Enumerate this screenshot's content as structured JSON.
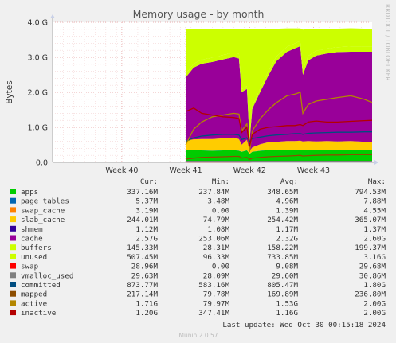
{
  "chart_data": {
    "type": "area",
    "title": "Memory usage - by month",
    "ylabel": "Bytes",
    "ylim": [
      0,
      4.0
    ],
    "y_unit": "G",
    "y_ticks": [
      "0.0",
      "1.0 G",
      "2.0 G",
      "3.0 G",
      "4.0 G"
    ],
    "x_ticks": [
      "Week 40",
      "Week 41",
      "Week 42",
      "Week 43"
    ],
    "x_tick_positions": [
      2.6,
      5.0,
      7.4,
      9.8
    ],
    "xlim": [
      0,
      12
    ],
    "grid": true,
    "side_label": "RRDTOOL / TOBI OETIKER",
    "legend_headers": [
      "Cur:",
      "Min:",
      "Avg:",
      "Max:"
    ],
    "stack_order": [
      "apps",
      "page_tables",
      "swap_cache",
      "slab_cache",
      "shmem",
      "cache",
      "buffers",
      "unused"
    ],
    "line_order": [
      "swap",
      "vmalloc_used",
      "committed",
      "mapped",
      "active",
      "inactive"
    ],
    "x": [
      5.0,
      5.3,
      5.6,
      6.0,
      6.4,
      6.8,
      7.0,
      7.1,
      7.3,
      7.4,
      7.5,
      7.8,
      8.1,
      8.4,
      8.8,
      9.1,
      9.3,
      9.4,
      9.6,
      9.9,
      10.3,
      10.7,
      11.2,
      11.7,
      12.0
    ],
    "series": [
      {
        "name": "apps",
        "color": "#00cc00",
        "cur": "337.16M",
        "min": "237.84M",
        "avg": "348.65M",
        "max": "794.53M",
        "values": [
          0.34,
          0.35,
          0.34,
          0.33,
          0.34,
          0.35,
          0.33,
          0.3,
          0.34,
          0.24,
          0.3,
          0.33,
          0.35,
          0.34,
          0.35,
          0.34,
          0.35,
          0.34,
          0.35,
          0.34,
          0.35,
          0.34,
          0.35,
          0.34,
          0.34
        ]
      },
      {
        "name": "page_tables",
        "color": "#0066b3",
        "cur": "5.37M",
        "min": "3.48M",
        "avg": "4.96M",
        "max": "7.88M",
        "values": [
          0.005,
          0.005,
          0.005,
          0.005,
          0.005,
          0.005,
          0.005,
          0.005,
          0.005,
          0.004,
          0.005,
          0.005,
          0.005,
          0.005,
          0.005,
          0.005,
          0.005,
          0.005,
          0.005,
          0.005,
          0.005,
          0.005,
          0.005,
          0.005,
          0.005
        ]
      },
      {
        "name": "swap_cache",
        "color": "#ff8000",
        "cur": "3.19M",
        "min": "0.00",
        "avg": "1.39M",
        "max": "4.55M",
        "values": [
          0.0,
          0.001,
          0.001,
          0.001,
          0.001,
          0.001,
          0.001,
          0.001,
          0.001,
          0.0,
          0.001,
          0.001,
          0.001,
          0.001,
          0.001,
          0.001,
          0.002,
          0.002,
          0.002,
          0.002,
          0.003,
          0.003,
          0.003,
          0.003,
          0.003
        ]
      },
      {
        "name": "slab_cache",
        "color": "#ffcc00",
        "cur": "244.01M",
        "min": "74.79M",
        "avg": "254.42M",
        "max": "365.07M",
        "values": [
          0.28,
          0.3,
          0.32,
          0.33,
          0.34,
          0.35,
          0.33,
          0.2,
          0.3,
          0.08,
          0.12,
          0.18,
          0.22,
          0.24,
          0.25,
          0.26,
          0.26,
          0.25,
          0.25,
          0.25,
          0.25,
          0.25,
          0.25,
          0.24,
          0.24
        ]
      },
      {
        "name": "shmem",
        "color": "#330099",
        "cur": "1.12M",
        "min": "1.08M",
        "avg": "1.17M",
        "max": "1.37M",
        "values": [
          0.001,
          0.001,
          0.001,
          0.001,
          0.001,
          0.001,
          0.001,
          0.001,
          0.001,
          0.001,
          0.001,
          0.001,
          0.001,
          0.001,
          0.001,
          0.001,
          0.001,
          0.001,
          0.001,
          0.001,
          0.001,
          0.001,
          0.001,
          0.001,
          0.001
        ]
      },
      {
        "name": "cache",
        "color": "#990099",
        "cur": "2.57G",
        "min": "253.06M",
        "avg": "2.32G",
        "max": "2.60G",
        "values": [
          1.8,
          2.05,
          2.15,
          2.2,
          2.25,
          2.3,
          2.3,
          1.5,
          1.45,
          0.3,
          1.1,
          1.5,
          1.9,
          2.3,
          2.55,
          2.65,
          2.7,
          1.9,
          2.3,
          2.45,
          2.5,
          2.55,
          2.55,
          2.57,
          2.57
        ]
      },
      {
        "name": "buffers",
        "color": "#ccff00",
        "cur": "145.33M",
        "min": "28.31M",
        "avg": "158.22M",
        "max": "199.37M",
        "values": [
          0.1,
          0.11,
          0.12,
          0.12,
          0.13,
          0.13,
          0.13,
          0.08,
          0.08,
          0.03,
          0.08,
          0.1,
          0.12,
          0.13,
          0.14,
          0.14,
          0.15,
          0.12,
          0.13,
          0.14,
          0.14,
          0.14,
          0.15,
          0.15,
          0.15
        ]
      },
      {
        "name": "unused",
        "color": "#ccff00",
        "cur": "507.45M",
        "min": "96.33M",
        "avg": "733.85M",
        "max": "3.16G",
        "values": [
          1.27,
          0.98,
          0.86,
          0.81,
          0.75,
          0.68,
          0.72,
          1.72,
          1.63,
          3.15,
          2.2,
          1.69,
          1.22,
          0.8,
          0.53,
          0.43,
          0.36,
          1.17,
          0.78,
          0.63,
          0.57,
          0.53,
          0.52,
          0.51,
          0.51
        ]
      },
      {
        "name": "swap",
        "color": "#ff0000",
        "cur": "28.96M",
        "min": "0.00",
        "avg": "9.08M",
        "max": "29.68M",
        "values": [
          0.0,
          0.0,
          0.0,
          0.0,
          0.0,
          0.0,
          0.0,
          0.0,
          0.0,
          0.0,
          0.005,
          0.005,
          0.006,
          0.007,
          0.008,
          0.009,
          0.01,
          0.01,
          0.012,
          0.015,
          0.02,
          0.025,
          0.028,
          0.029,
          0.029
        ]
      },
      {
        "name": "vmalloc_used",
        "color": "#808080",
        "cur": "29.63M",
        "min": "28.09M",
        "avg": "29.60M",
        "max": "30.86M",
        "values": [
          0.029,
          0.029,
          0.029,
          0.029,
          0.029,
          0.029,
          0.029,
          0.029,
          0.029,
          0.028,
          0.029,
          0.029,
          0.029,
          0.029,
          0.029,
          0.029,
          0.03,
          0.03,
          0.03,
          0.03,
          0.03,
          0.03,
          0.03,
          0.03,
          0.03
        ]
      },
      {
        "name": "committed",
        "color": "#004d80",
        "cur": "873.77M",
        "min": "583.16M",
        "avg": "805.47M",
        "max": "1.80G",
        "values": [
          0.6,
          0.7,
          0.75,
          0.78,
          0.8,
          0.8,
          0.78,
          0.65,
          0.7,
          0.6,
          0.68,
          0.72,
          0.76,
          0.78,
          0.8,
          0.82,
          0.82,
          0.8,
          0.83,
          0.84,
          0.85,
          0.86,
          0.86,
          0.87,
          0.87
        ]
      },
      {
        "name": "mapped",
        "color": "#8c4d00",
        "cur": "217.14M",
        "min": "79.78M",
        "avg": "169.89M",
        "max": "236.80M",
        "values": [
          0.09,
          0.12,
          0.14,
          0.15,
          0.16,
          0.17,
          0.17,
          0.12,
          0.14,
          0.08,
          0.12,
          0.14,
          0.16,
          0.17,
          0.18,
          0.19,
          0.2,
          0.18,
          0.19,
          0.2,
          0.21,
          0.21,
          0.22,
          0.22,
          0.22
        ]
      },
      {
        "name": "active",
        "color": "#b38600",
        "cur": "1.71G",
        "min": "79.97M",
        "avg": "1.53G",
        "max": "2.00G",
        "values": [
          0.5,
          0.95,
          1.15,
          1.3,
          1.35,
          1.4,
          1.38,
          0.9,
          1.1,
          0.3,
          0.9,
          1.25,
          1.5,
          1.7,
          1.9,
          1.95,
          2.0,
          1.4,
          1.65,
          1.75,
          1.8,
          1.85,
          1.9,
          1.8,
          1.71
        ]
      },
      {
        "name": "inactive",
        "color": "#b30000",
        "cur": "1.20G",
        "min": "347.41M",
        "avg": "1.16G",
        "max": "2.00G",
        "values": [
          1.45,
          1.55,
          1.4,
          1.35,
          1.3,
          1.28,
          1.25,
          0.85,
          1.0,
          0.45,
          0.8,
          0.95,
          1.0,
          1.02,
          1.05,
          1.05,
          1.08,
          1.05,
          1.15,
          1.18,
          1.15,
          1.15,
          1.17,
          1.19,
          1.2
        ]
      }
    ]
  },
  "footer": {
    "last_update": "Last update: Wed Oct 30 00:15:18 2024",
    "version": "Munin 2.0.57"
  }
}
